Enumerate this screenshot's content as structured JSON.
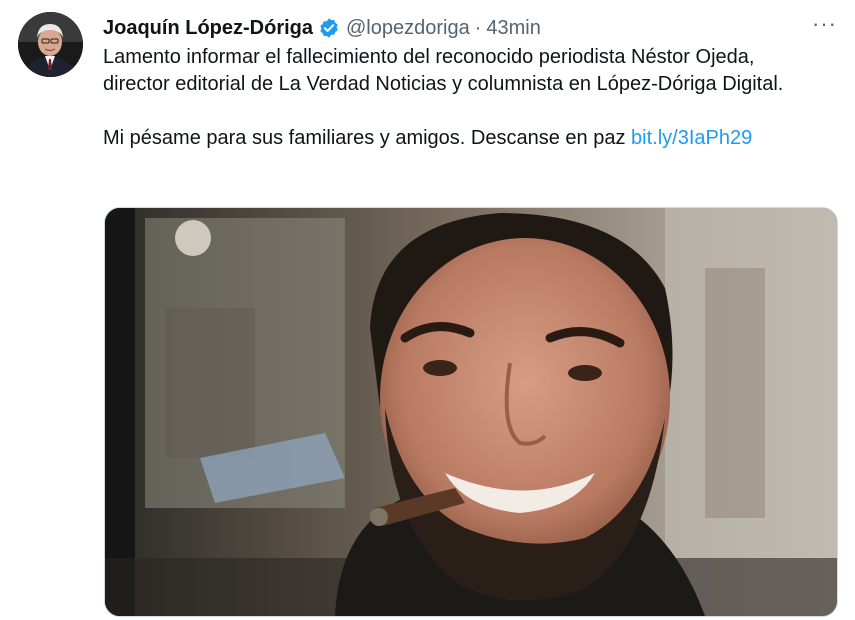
{
  "tweet": {
    "author_name": "Joaquín López-Dóriga",
    "handle": "@lopezdoriga",
    "separator": "·",
    "time": "43min",
    "more_label": "···",
    "paragraph1": "Lamento informar el fallecimiento del reconocido periodista Néstor Ojeda, director editorial de La Verdad Noticias y columnista en López-Dóriga Digital.",
    "paragraph2_text": "Mi pésame para sus familiares y amigos. Descanse en paz ",
    "link_text": "bit.ly/3IaPh29"
  },
  "colors": {
    "text": "#0f1419",
    "secondary": "#536471",
    "link": "#1d9bf0",
    "verified": "#1d9bf0"
  },
  "icons": {
    "verified": "verified-badge-icon",
    "more": "more-horizontal-icon"
  }
}
